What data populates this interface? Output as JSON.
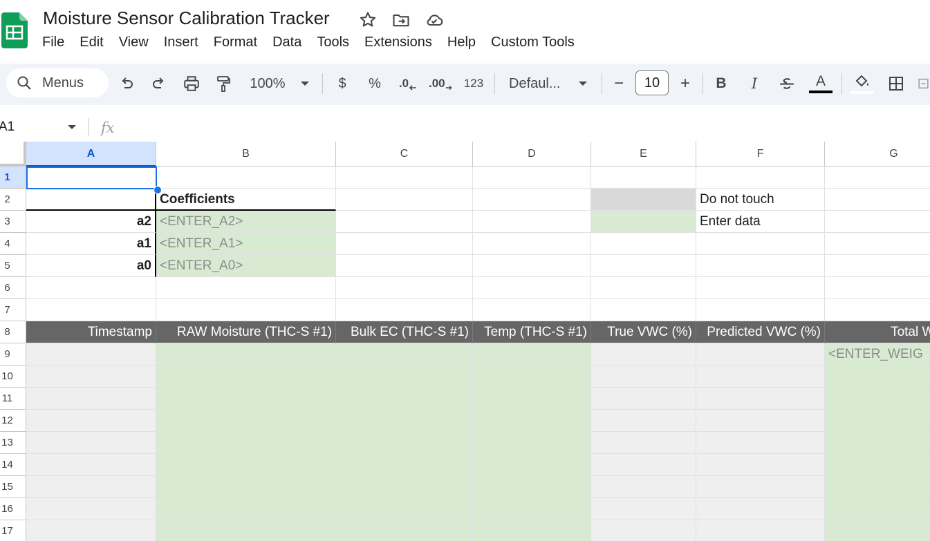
{
  "app": {
    "title": "Moisture Sensor Calibration Tracker",
    "menus": [
      "File",
      "Edit",
      "View",
      "Insert",
      "Format",
      "Data",
      "Tools",
      "Extensions",
      "Help",
      "Custom Tools"
    ]
  },
  "toolbar": {
    "search_label": "Menus",
    "zoom": "100%",
    "currency": "$",
    "percent": "%",
    "decrease_decimal": ".0",
    "increase_decimal": ".00",
    "number_format": "123",
    "font": "Defaul...",
    "font_size": "10",
    "minus": "−",
    "plus": "+",
    "bold": "B",
    "italic": "I",
    "text_color_letter": "A"
  },
  "formula_bar": {
    "name_box": "A1",
    "fx": "fx"
  },
  "colors": {
    "header_fill": "#666666",
    "entry_fill": "#d9ead3",
    "computed_fill": "#efefef",
    "legend_protected": "#d9d9d9",
    "selection": "#1a73e8"
  },
  "sheet": {
    "columns": [
      "A",
      "B",
      "C",
      "D",
      "E",
      "F",
      "G"
    ],
    "rows": [
      "1",
      "2",
      "3",
      "4",
      "5",
      "6",
      "7",
      "8",
      "9",
      "10",
      "11",
      "12",
      "13",
      "14",
      "15",
      "16",
      "17"
    ],
    "cells": {
      "B2": "Coefficients",
      "A3": "a2",
      "B3": "<ENTER_A2>",
      "A4": "a1",
      "B4": "<ENTER_A1>",
      "A5": "a0",
      "B5": "<ENTER_A0>",
      "F2": "Do not touch",
      "F3": "Enter data",
      "A8": "Timestamp",
      "B8": "RAW Moisture (THC-S #1)",
      "C8": "Bulk EC (THC-S #1)",
      "D8": "Temp (THC-S #1)",
      "E8": "True VWC (%)",
      "F8": "Predicted VWC (%)",
      "G8": "Total Weigh",
      "G9": "<ENTER_WEIG"
    }
  }
}
